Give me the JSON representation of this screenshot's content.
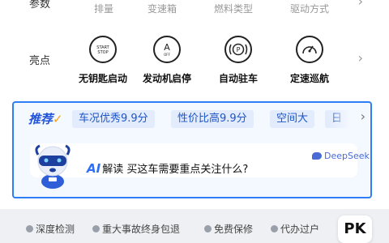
{
  "params": {
    "label": "参数",
    "items": [
      "排量",
      "变速箱",
      "燃料类型",
      "驱动方式"
    ]
  },
  "highlights": {
    "label": "亮点",
    "items": [
      {
        "icon": "start-stop-button-icon",
        "icon_text": "START\nSTOP",
        "label": "无钥匙启动"
      },
      {
        "icon": "auto-start-stop-icon",
        "icon_text": "A",
        "label": "发动机启停"
      },
      {
        "icon": "parking-brake-icon",
        "icon_text": "(P)",
        "label": "自动驻车"
      },
      {
        "icon": "cruise-control-icon",
        "icon_text": "",
        "label": "定速巡航"
      }
    ]
  },
  "recommend": {
    "logo_main": "推荐",
    "tags": [
      "车况优秀9.9分",
      "性价比高9.9分",
      "空间大",
      "日"
    ]
  },
  "ai": {
    "prefix": "AI",
    "question": "解读 买这车需要重点关注什么?",
    "provider": "DeepSeek"
  },
  "features": [
    "深度检测",
    "重大事故终身包退",
    "免费保修",
    "代办过户"
  ],
  "pk_label": "PK",
  "colors": {
    "accent": "#2f7ef5",
    "tag_text": "#1f55c8",
    "tag_bg": "#e2ecfd"
  }
}
